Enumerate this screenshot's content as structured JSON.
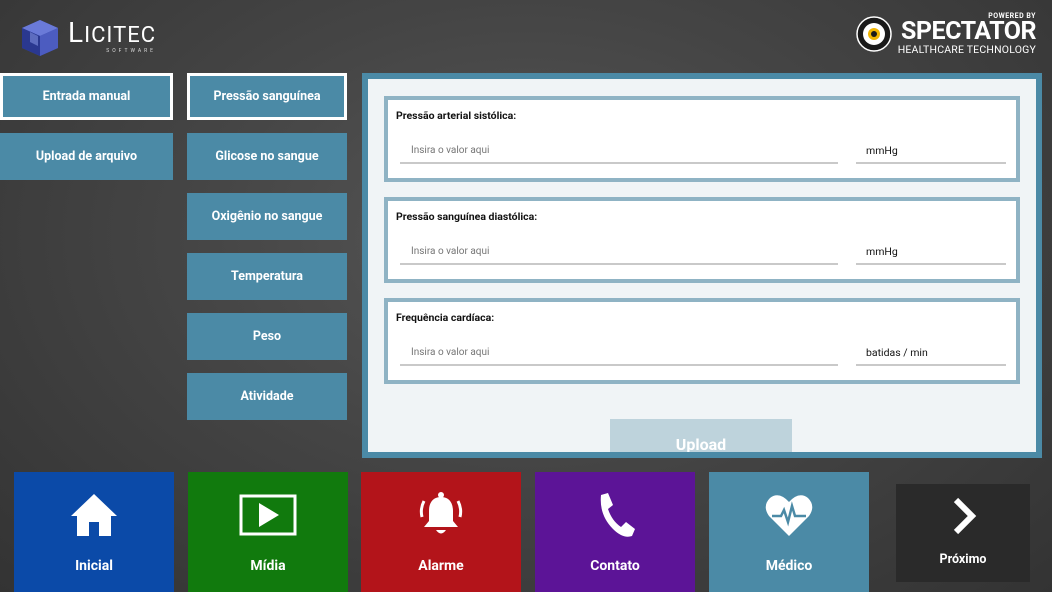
{
  "header": {
    "left_logo": {
      "name_first": "L",
      "name_rest": "ICITEC",
      "sub": "SOFTWARE"
    },
    "right_logo": {
      "powered_by": "POWERED BY",
      "brand": "SPECTATOR",
      "tagline": "HEALTHCARE TECHNOLOGY"
    }
  },
  "input_mode": {
    "items": [
      {
        "label": "Entrada manual",
        "selected": true
      },
      {
        "label": "Upload de arquivo",
        "selected": false
      }
    ]
  },
  "measurements": {
    "items": [
      {
        "label": "Pressão sanguínea",
        "selected": true
      },
      {
        "label": "Glicose no sangue",
        "selected": false
      },
      {
        "label": "Oxigênio no sangue",
        "selected": false
      },
      {
        "label": "Temperatura",
        "selected": false
      },
      {
        "label": "Peso",
        "selected": false
      },
      {
        "label": "Atividade",
        "selected": false
      }
    ]
  },
  "form": {
    "fields": [
      {
        "title": "Pressão arterial sistólica:",
        "placeholder": "Insira o valor aqui",
        "unit": "mmHg"
      },
      {
        "title": "Pressão sanguínea diastólica:",
        "placeholder": "Insira o valor aqui",
        "unit": "mmHg"
      },
      {
        "title": "Frequência cardíaca:",
        "placeholder": "Insira o valor aqui",
        "unit": "batidas / min"
      }
    ],
    "upload_label": "Upload"
  },
  "nav": {
    "tiles": [
      {
        "label": "Inicial",
        "icon": "home-icon",
        "color": "#0b4aa8"
      },
      {
        "label": "Mídia",
        "icon": "media-play-icon",
        "color": "#117a0d"
      },
      {
        "label": "Alarme",
        "icon": "bell-icon",
        "color": "#b3141a"
      },
      {
        "label": "Contato",
        "icon": "phone-icon",
        "color": "#5c1497"
      },
      {
        "label": "Médico",
        "icon": "heart-pulse-icon",
        "color": "#4b8aa6"
      }
    ],
    "next": {
      "label": "Próximo",
      "icon": "chevron-right-icon",
      "color": "#2a2a2a"
    }
  },
  "colors": {
    "accent": "#4b8aa6",
    "panel_bg": "#f0f4f6",
    "card_border": "#8fb3c4"
  }
}
